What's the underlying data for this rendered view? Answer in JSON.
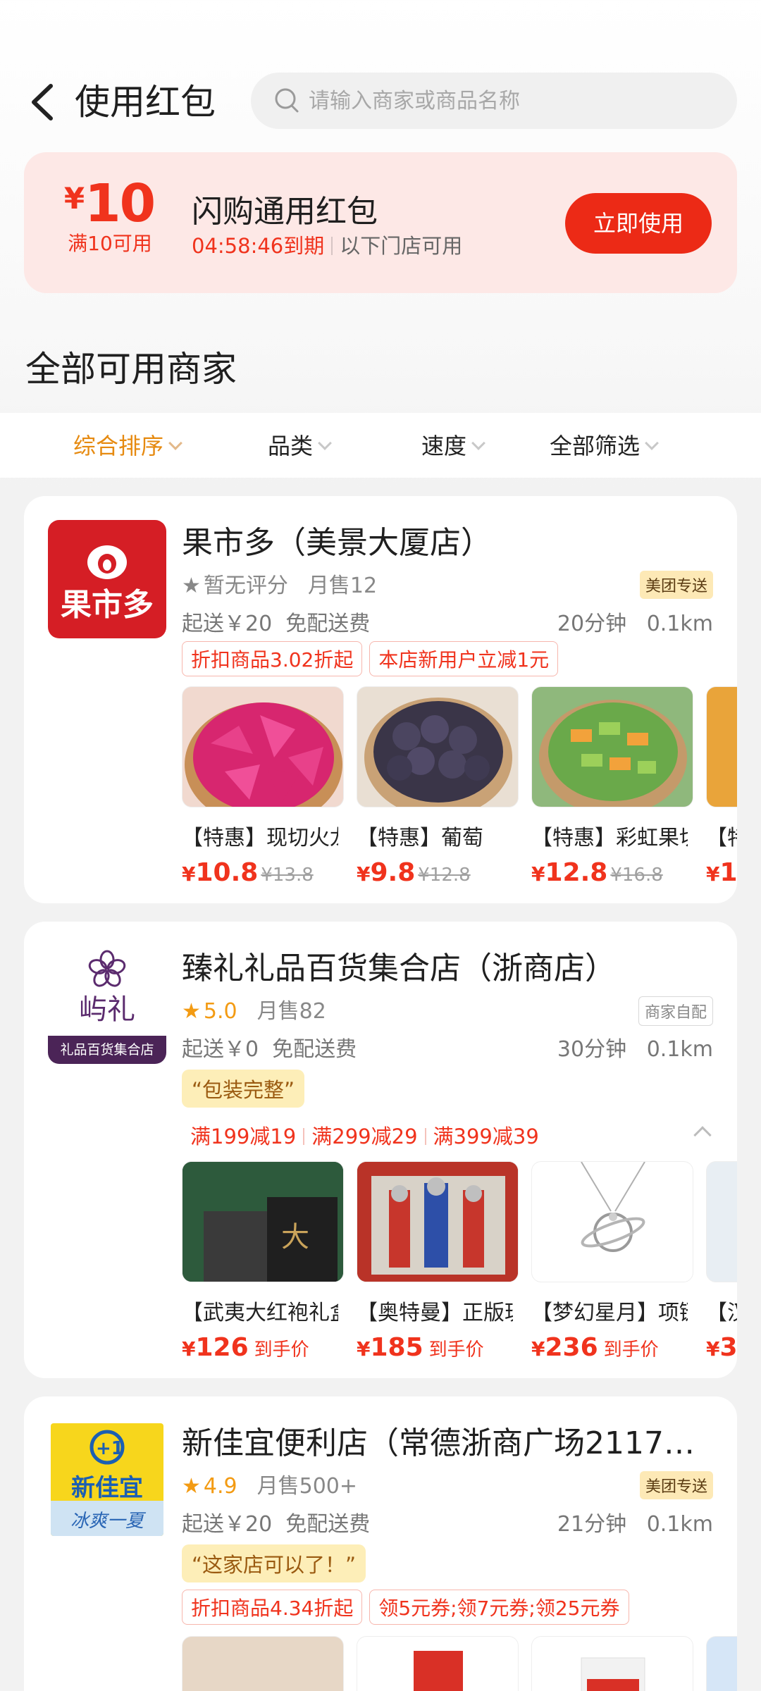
{
  "header": {
    "title": "使用红包",
    "search_placeholder": "请输入商家或商品名称"
  },
  "coupon": {
    "currency": "¥",
    "amount": "10",
    "condition": "满10可用",
    "name": "闪购通用红包",
    "expire": "04:58:46到期",
    "scope": "以下门店可用",
    "use_button": "立即使用"
  },
  "section_title": "全部可用商家",
  "filters": [
    "综合排序",
    "品类",
    "速度",
    "全部筛选"
  ],
  "stores": [
    {
      "logo_text": "果市多",
      "name": "果市多（美景大厦店）",
      "rating": "暂无评分",
      "sales": "月售12",
      "badge": "美团专送",
      "min_order": "起送￥20",
      "delivery_fee": "免配送费",
      "time": "20分钟",
      "distance": "0.1km",
      "tags": [
        "折扣商品3.02折起",
        "本店新用户立减1元"
      ],
      "products": [
        {
          "name": "【特惠】现切火龙果",
          "price": "10.8",
          "orig": "¥13.8"
        },
        {
          "name": "【特惠】葡萄",
          "price": "9.8",
          "orig": "¥12.8"
        },
        {
          "name": "【特惠】彩虹果切",
          "price": "12.8",
          "orig": "¥16.8"
        },
        {
          "name": "【特",
          "price": "1"
        }
      ]
    },
    {
      "logo_text": "屿礼",
      "logo_sub": "礼品百货集合店",
      "name": "臻礼礼品百货集合店（浙商店）",
      "rating": "5.0",
      "sales": "月售82",
      "badge": "商家自配",
      "min_order": "起送￥0",
      "delivery_fee": "免配送费",
      "time": "30分钟",
      "distance": "0.1km",
      "quote": "“包装完整”",
      "promos": [
        "满199减19",
        "满299减29",
        "满399减39"
      ],
      "products": [
        {
          "name": "【武夷大红袍礼盒】",
          "price": "126",
          "suffix": "到手价"
        },
        {
          "name": "【奥特曼】正版玩具",
          "price": "185",
          "suffix": "到手价"
        },
        {
          "name": "【梦幻星月】项链",
          "price": "236",
          "suffix": "到手价"
        },
        {
          "name": "【汉",
          "price": "3"
        }
      ]
    },
    {
      "logo_text": "新佳宜",
      "logo_sub": "冰爽一夏",
      "name": "新佳宜便利店（常德浙商广场2117…",
      "rating": "4.9",
      "sales": "月售500+",
      "badge": "美团专送",
      "min_order": "起送￥20",
      "delivery_fee": "免配送费",
      "time": "21分钟",
      "distance": "0.1km",
      "quote": "“这家店可以了！”",
      "tags": [
        "折扣商品4.34折起",
        "领5元券;领7元券;领25元券"
      ]
    }
  ],
  "colors": {
    "accent_red": "#f0331d",
    "accent_orange": "#e68a10",
    "coupon_bg": "#fde8e6"
  }
}
